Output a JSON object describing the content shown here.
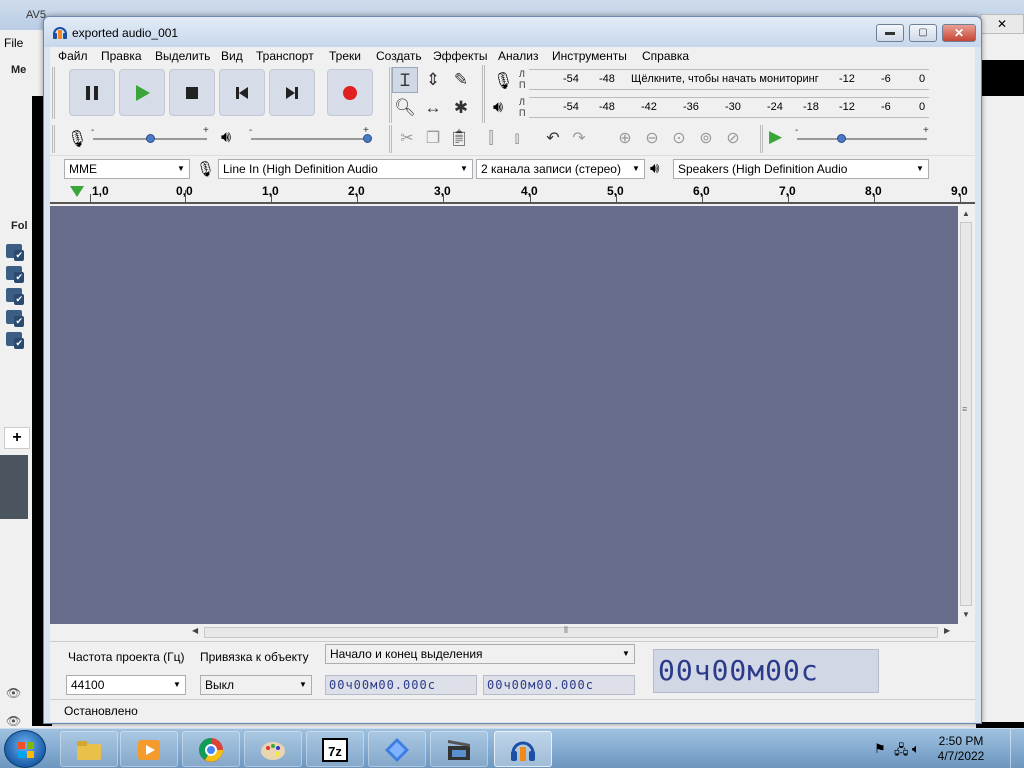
{
  "background_app": {
    "title": "AV5",
    "menu_file": "File",
    "side_label_1": "Me",
    "side_label_2": "Fol"
  },
  "window": {
    "title": "exported audio_001",
    "min_label": "▬",
    "max_label": "▢",
    "close_label": "✕"
  },
  "menu": {
    "items": [
      "Файл",
      "Правка",
      "Выделить",
      "Вид",
      "Транспорт",
      "Треки",
      "Создать",
      "Эффекты",
      "Анализ",
      "Инструменты",
      "Справка"
    ]
  },
  "meters": {
    "lr_top": "Л",
    "lr_bottom": "П",
    "record_scale_left": [
      "-54",
      "-48"
    ],
    "monitor_text": "Щёлкните, чтобы начать мониторинг",
    "record_scale_right": [
      "-12",
      "-6",
      "0"
    ],
    "playback_scale": [
      "-54",
      "-48",
      "-42",
      "-36",
      "-30",
      "-24",
      "-18",
      "-12",
      "-6",
      "0"
    ]
  },
  "mixer": {
    "minus": "-",
    "plus": "+"
  },
  "device": {
    "host": "MME",
    "input": "Line In (High Definition Audio",
    "channels": "2  канала записи (стерео)",
    "output": "Speakers (High Definition Audio"
  },
  "ruler": {
    "labels": [
      "1,0",
      "0,0",
      "1,0",
      "2,0",
      "3,0",
      "4,0",
      "5,0",
      "6,0",
      "7,0",
      "8,0",
      "9,0"
    ]
  },
  "selection": {
    "rate_label": "Частота проекта (Гц)",
    "rate_value": "44100",
    "snap_label": "Привязка к объекту",
    "snap_value": "Выкл",
    "sel_mode": "Начало и конец выделения",
    "start_time": "00ч00м00.000с",
    "end_time": "00ч00м00.000с",
    "big_time": "00ч00м00с"
  },
  "status": {
    "text": "Остановлено"
  },
  "taskbar": {
    "time": "2:50 PM",
    "date": "4/7/2022"
  },
  "colors": {
    "track_bg": "#686c8b",
    "record_red": "#e02020",
    "play_green": "#3aa63a",
    "time_text": "#2b3b8a"
  }
}
